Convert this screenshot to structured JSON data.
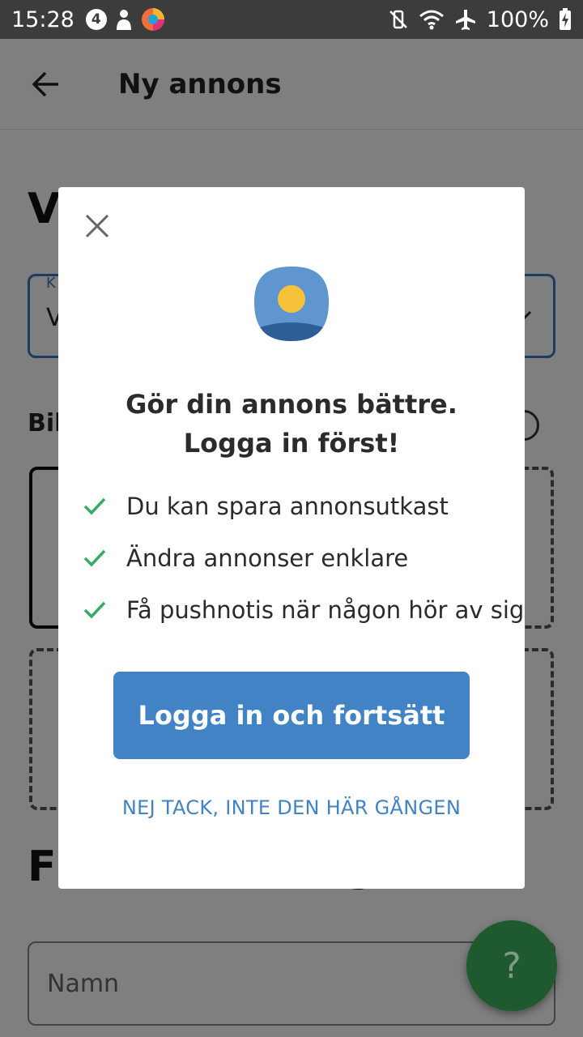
{
  "status_bar": {
    "time": "15:28",
    "notification_badge": "4",
    "battery": "100%",
    "icons": [
      "notification-4-icon",
      "person-icon",
      "browser-icon",
      "vibrate-icon",
      "wifi-icon",
      "airplane-mode-icon",
      "battery-charging-icon"
    ]
  },
  "app_bar": {
    "title": "Ny annons",
    "back_icon": "arrow-back-icon"
  },
  "background": {
    "heading_partial": "V",
    "category_label_partial": "K",
    "category_value_partial": "V",
    "images_label_partial": "Bil",
    "bottom_heading_left": "F",
    "bottom_heading_right": "ng",
    "name_placeholder": "Namn"
  },
  "dialog": {
    "title_line1": "Gör din annons bättre.",
    "title_line2": "Logga in först!",
    "benefits": [
      "Du kan spara annonsutkast",
      "Ändra annonser enklare",
      "Få pushnotis när någon hör av sig"
    ],
    "primary_button": "Logga in och fortsätt",
    "secondary_link": "NEJ TACK, INTE DEN HÄR GÅNGEN"
  },
  "help_fab": {
    "label": "?"
  },
  "colors": {
    "accent": "#4183c4",
    "check": "#3aa86a",
    "sun": "#f7c23a",
    "sky": "#5f96cf",
    "help_fab": "#1f5a2f"
  }
}
